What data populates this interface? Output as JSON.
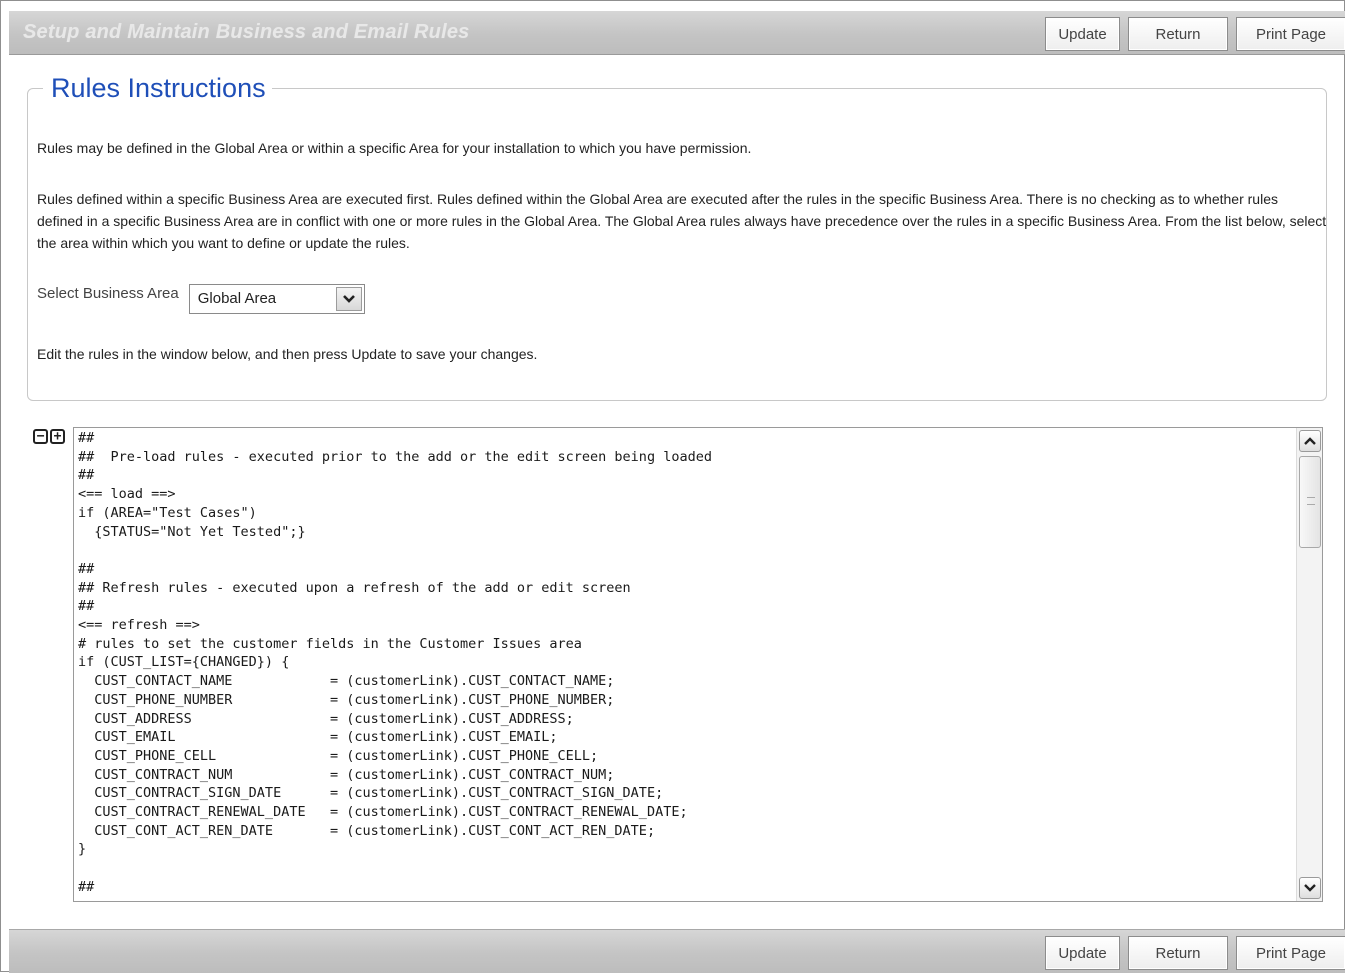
{
  "header": {
    "title": "Setup and Maintain Business and Email Rules",
    "buttons": {
      "update": "Update",
      "return": "Return",
      "print": "Print Page"
    }
  },
  "instructions": {
    "legend": "Rules Instructions",
    "paragraph1": "Rules may be defined in the Global Area or within a specific Area for your installation to which you have permission.",
    "paragraph2": "Rules defined within a specific Business Area are executed first. Rules defined within the Global Area are executed after the rules in the specific Business Area. There is no checking as to whether rules defined in a specific Business Area are in conflict with one or more rules in the Global Area. The Global Area rules always have precedence over the rules in a specific Business Area. From the list below, select the area within which you want to define or update the rules.",
    "select_label": "Select Business Area",
    "select_value": "Global Area",
    "paragraph3": "Edit the rules in the window below, and then press Update to save your changes."
  },
  "editor": {
    "collapse_icon": "collapse-all-icon",
    "expand_icon": "expand-all-icon",
    "code": "##\n##  Pre-load rules - executed prior to the add or the edit screen being loaded\n##\n<== load ==>\nif (AREA=\"Test Cases\")\n  {STATUS=\"Not Yet Tested\";}\n\n##\n## Refresh rules - executed upon a refresh of the add or edit screen\n##\n<== refresh ==>\n# rules to set the customer fields in the Customer Issues area\nif (CUST_LIST={CHANGED}) {\n  CUST_CONTACT_NAME            = (customerLink).CUST_CONTACT_NAME;\n  CUST_PHONE_NUMBER            = (customerLink).CUST_PHONE_NUMBER;\n  CUST_ADDRESS                 = (customerLink).CUST_ADDRESS;\n  CUST_EMAIL                   = (customerLink).CUST_EMAIL;\n  CUST_PHONE_CELL              = (customerLink).CUST_PHONE_CELL;\n  CUST_CONTRACT_NUM            = (customerLink).CUST_CONTRACT_NUM;\n  CUST_CONTRACT_SIGN_DATE      = (customerLink).CUST_CONTRACT_SIGN_DATE;\n  CUST_CONTRACT_RENEWAL_DATE   = (customerLink).CUST_CONTRACT_RENEWAL_DATE;\n  CUST_CONT_ACT_REN_DATE       = (customerLink).CUST_CONT_ACT_REN_DATE;\n}\n\n##"
  },
  "footer": {
    "buttons": {
      "update": "Update",
      "return": "Return",
      "print": "Print Page"
    }
  },
  "colors": {
    "legend": "#1f4fb8",
    "bar": "#c4c4c4",
    "title_text": "#e8e8e8"
  }
}
